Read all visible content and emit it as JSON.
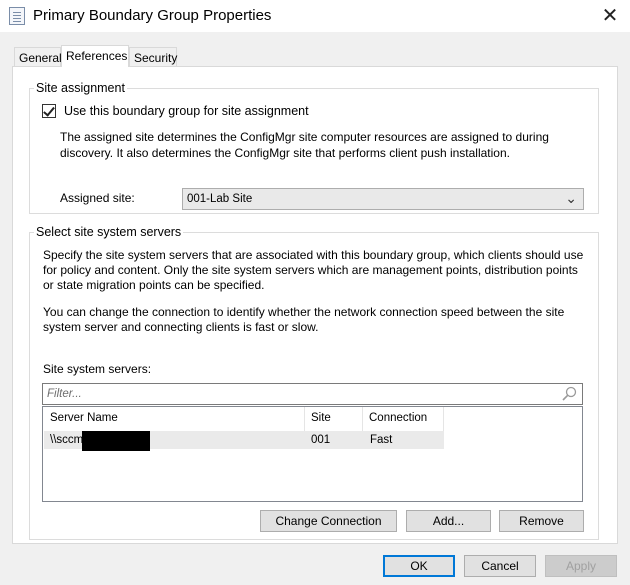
{
  "window": {
    "title": "Primary Boundary Group Properties",
    "close_glyph": "✕"
  },
  "tabs": [
    {
      "label": "General",
      "active": false
    },
    {
      "label": "References",
      "active": true
    },
    {
      "label": "Security",
      "active": false
    }
  ],
  "site_assignment": {
    "group_label": "Site assignment",
    "checkbox_label": "Use this boundary group for site assignment",
    "checked": true,
    "description_line1": "The assigned site determines the ConfigMgr site computer resources are assigned to during",
    "description_line2": "discovery. It also determines the ConfigMgr site that performs client push installation.",
    "assigned_site_label": "Assigned site:",
    "assigned_site_value": "001-Lab Site"
  },
  "site_servers": {
    "group_label": "Select site system servers",
    "desc1_line1": "Specify the site system servers that are associated with this boundary group, which clients should use",
    "desc1_line2": "for policy and content. Only the site system servers which are management points, distribution points",
    "desc1_line3": "or state migration points can be specified.",
    "desc2_line1": "You can change the connection to identify whether the network connection speed between the site",
    "desc2_line2": "system server and connecting clients is fast or slow.",
    "list_label": "Site system servers:",
    "filter_placeholder": "Filter...",
    "columns": [
      "Server Name",
      "Site",
      "Connection"
    ],
    "rows": [
      {
        "server": "\\\\sccm",
        "site": "001",
        "connection": "Fast"
      }
    ],
    "buttons": {
      "change_connection": "Change Connection",
      "add": "Add...",
      "remove": "Remove"
    }
  },
  "footer": {
    "ok": "OK",
    "cancel": "Cancel",
    "apply": "Apply"
  },
  "colors": {
    "default_button_border": "#0078d7",
    "row_highlight": "#eaeaea"
  }
}
